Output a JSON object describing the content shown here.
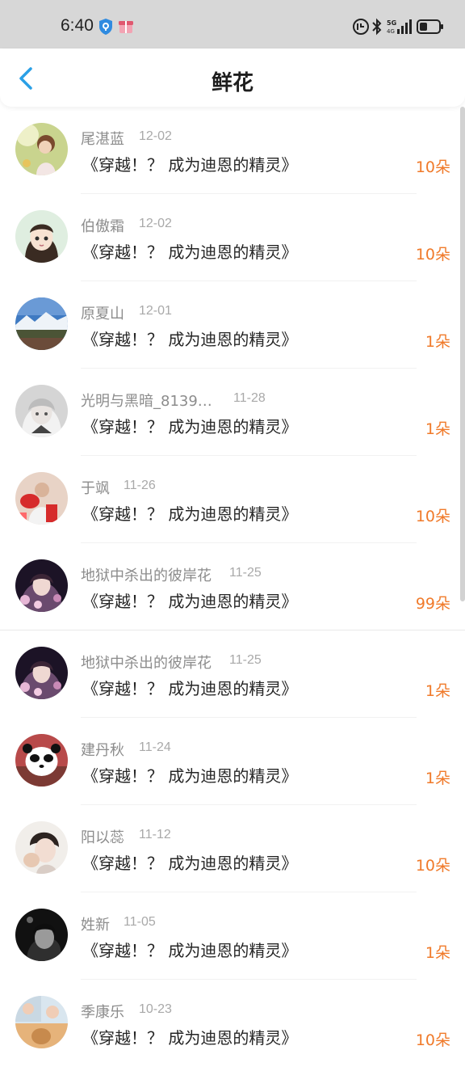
{
  "status_bar": {
    "time": "6:40",
    "icons": [
      "shield-icon",
      "gift-icon",
      "alarm-icon",
      "bluetooth-icon",
      "signal-5g-icon",
      "battery-icon"
    ]
  },
  "header": {
    "title": "鲜花",
    "back_icon": "chevron-left-icon"
  },
  "colors": {
    "accent": "#2aa0e6",
    "count": "#f07a2a"
  },
  "items": [
    {
      "name": "尾湛蓝",
      "date": "12-02",
      "book": "《穿越！？ 成为迪恩的精灵》",
      "count": "10朵"
    },
    {
      "name": "伯傲霜",
      "date": "12-02",
      "book": "《穿越！？ 成为迪恩的精灵》",
      "count": "10朵"
    },
    {
      "name": "原夏山",
      "date": "12-01",
      "book": "《穿越！？ 成为迪恩的精灵》",
      "count": "1朵"
    },
    {
      "name": "光明与黑暗_8139…",
      "date": "11-28",
      "book": "《穿越！？ 成为迪恩的精灵》",
      "count": "1朵"
    },
    {
      "name": "于飒",
      "date": "11-26",
      "book": "《穿越！？ 成为迪恩的精灵》",
      "count": "10朵"
    },
    {
      "name": "地狱中杀出的彼岸花",
      "date": "11-25",
      "book": "《穿越！？ 成为迪恩的精灵》",
      "count": "99朵"
    },
    {
      "name": "地狱中杀出的彼岸花",
      "date": "11-25",
      "book": "《穿越！？ 成为迪恩的精灵》",
      "count": "1朵"
    },
    {
      "name": "建丹秋",
      "date": "11-24",
      "book": "《穿越！？ 成为迪恩的精灵》",
      "count": "1朵"
    },
    {
      "name": "阳以蕊",
      "date": "11-12",
      "book": "《穿越！？ 成为迪恩的精灵》",
      "count": "10朵"
    },
    {
      "name": "姓新",
      "date": "11-05",
      "book": "《穿越！？ 成为迪恩的精灵》",
      "count": "1朵"
    },
    {
      "name": "季康乐",
      "date": "10-23",
      "book": "《穿越！？ 成为迪恩的精灵》",
      "count": "10朵"
    }
  ]
}
